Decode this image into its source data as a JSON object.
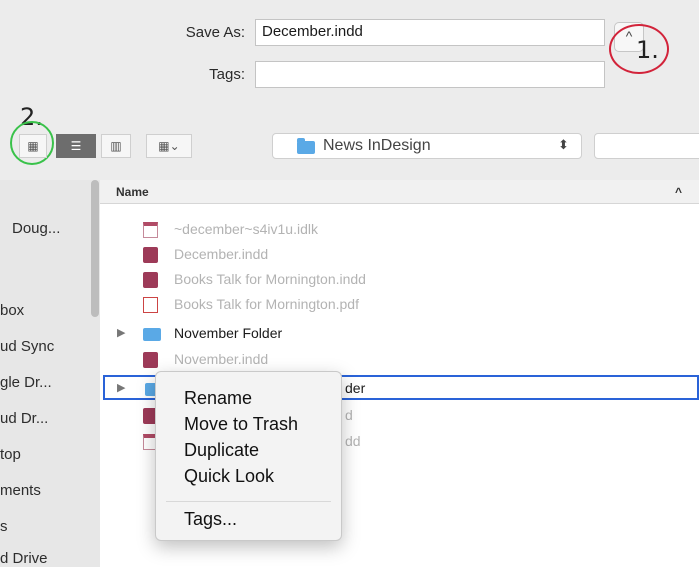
{
  "save": {
    "save_as_label": "Save As:",
    "filename": "December.indd",
    "tags_label": "Tags:",
    "tags_value": "",
    "expand_glyph": "^"
  },
  "annotations": {
    "one": "1.",
    "two": "2."
  },
  "toolbar": {
    "icon_view_glyph": "▦",
    "list_view_glyph": "☰",
    "column_view_glyph": "▥",
    "gallery_view_glyph": "▦⌄",
    "location": "News InDesign",
    "location_stepper": "⬍"
  },
  "sidebar": {
    "items": [
      "Doug...",
      "box",
      "ud Sync",
      "gle Dr...",
      "ud Dr...",
      "top",
      "ments",
      "s",
      "d Drive"
    ]
  },
  "list": {
    "column_name": "Name",
    "sort_glyph": "^",
    "rows": [
      {
        "name": "~december~s4iv1u.idlk"
      },
      {
        "name": "December.indd"
      },
      {
        "name": "Books Talk for Mornington.indd"
      },
      {
        "name": "Books Talk for Mornington.pdf"
      },
      {
        "name": "November Folder"
      },
      {
        "name": "November.indd"
      },
      {
        "name": "der"
      },
      {
        "name": "d"
      },
      {
        "name": "dd"
      }
    ],
    "disclosure_glyph": "▶"
  },
  "context_menu": {
    "items": [
      "Rename",
      "Move to Trash",
      "Duplicate",
      "Quick Look"
    ],
    "tags": "Tags..."
  },
  "colors": {
    "selection_border": "#2a63d8",
    "annotation_red": "#d2233a",
    "annotation_green": "#39c24a",
    "folder_blue": "#5aa9e6"
  }
}
